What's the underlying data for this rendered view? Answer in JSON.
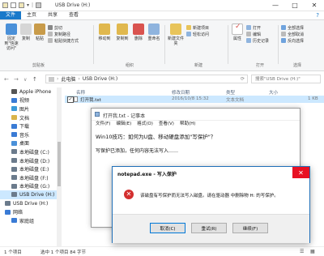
{
  "window": {
    "title": "USB Drive (H:)",
    "controls": {
      "minimize": "—",
      "maximize": "□",
      "close": "✕"
    }
  },
  "ribbon_tabs": [
    "文件",
    "主页",
    "共享",
    "查看"
  ],
  "ribbon": {
    "clipboard": {
      "pin_label": "固定到\"快速访问\"",
      "copy_label": "复制",
      "paste_label": "粘贴",
      "cut_label": "剪切",
      "copy_path_label": "复制路径",
      "paste_shortcut_label": "粘贴快捷方式",
      "group": "剪贴板"
    },
    "organize": {
      "move_to_label": "移动到",
      "copy_to_label": "复制到",
      "delete_label": "删除",
      "rename_label": "重命名",
      "group": "组织"
    },
    "new": {
      "new_folder_label": "新建文件夹",
      "new_item_label": "新建项目",
      "easy_access_label": "轻松访问",
      "group": "新建"
    },
    "open": {
      "properties_label": "属性",
      "open_label": "打开",
      "edit_label": "编辑",
      "history_label": "历史记录",
      "group": "打开"
    },
    "select": {
      "select_all_label": "全部选择",
      "select_none_label": "全部取消",
      "invert_label": "反向选择",
      "group": "选择"
    }
  },
  "address": {
    "path": [
      "此电脑",
      "USB Drive (H:)"
    ],
    "search_placeholder": "搜索\"USB Drive (H:)\""
  },
  "nav_pane": {
    "items": [
      {
        "label": "Apple iPhone",
        "color": "#555555"
      },
      {
        "label": "视频",
        "color": "#3a7bd5"
      },
      {
        "label": "图片",
        "color": "#3a9ad9"
      },
      {
        "label": "文档",
        "color": "#d9b44a"
      },
      {
        "label": "下载",
        "color": "#3a7bd5"
      },
      {
        "label": "音乐",
        "color": "#3a7bd5"
      },
      {
        "label": "桌面",
        "color": "#4a90d9"
      },
      {
        "label": "本地磁盘 (C:)",
        "color": "#6b7b8c"
      },
      {
        "label": "本地磁盘 (D:)",
        "color": "#6b7b8c"
      },
      {
        "label": "本地磁盘 (E:)",
        "color": "#6b7b8c"
      },
      {
        "label": "本地磁盘 (F:)",
        "color": "#6b7b8c"
      },
      {
        "label": "本地磁盘 (G:)",
        "color": "#6b7b8c"
      },
      {
        "label": "USB Drive (H:)",
        "color": "#6b7b8c",
        "selected": true
      },
      {
        "label": "USB Drive (H:)",
        "color": "#6b7b8c"
      },
      {
        "label": "网络",
        "color": "#3a7bd5"
      },
      {
        "label": "家庭组",
        "color": "#3a7bd5"
      }
    ]
  },
  "file_list": {
    "columns": [
      "名称",
      "修改日期",
      "类型",
      "大小"
    ],
    "rows": [
      {
        "name": "打开我.txt",
        "date": "2016/10/8 15:32",
        "type": "文本文档",
        "size": "1 KB"
      }
    ]
  },
  "status": {
    "count": "1 个项目",
    "selected": "选中 1 个项目 84 字节"
  },
  "notepad": {
    "title": "打开我.txt - 记事本",
    "menu": [
      "文件(F)",
      "编辑(E)",
      "格式(O)",
      "查看(V)",
      "帮助(H)"
    ],
    "line1": "Win10技巧：如何为U盘、移动硬盘添加\"写保护\"？",
    "line2": "写保护已添加，任何内容无法写入……"
  },
  "dialog": {
    "title": "notepad.exe - 写入保护",
    "message": "该磁盘有写保护而无法写入磁盘。请在驱动器 中删除物 H: 的写保护。",
    "buttons": [
      "取消(C)",
      "重试(R)",
      "继续(F)"
    ]
  }
}
